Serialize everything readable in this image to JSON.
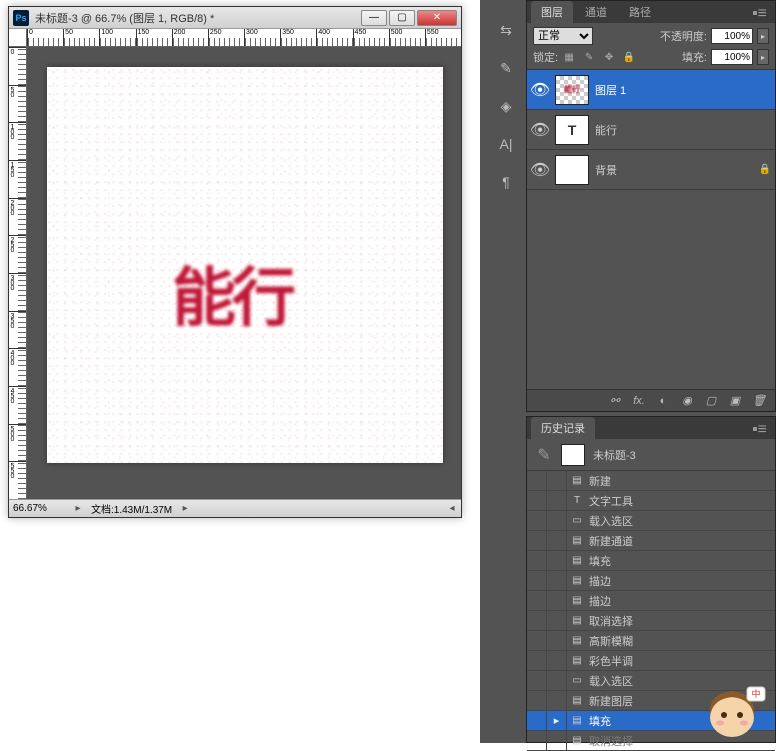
{
  "doc": {
    "title": "未标题-3 @ 66.7% (图层 1, RGB/8) *",
    "zoom": "66.67%",
    "filesize": "文档:1.43M/1.37M",
    "artwork_text": "能行"
  },
  "ruler_h": [
    "0",
    "50",
    "100",
    "150",
    "200",
    "250",
    "300",
    "350",
    "400",
    "450",
    "500",
    "550"
  ],
  "ruler_v": [
    "0",
    "50",
    "100",
    "150",
    "200",
    "250",
    "300",
    "350",
    "400",
    "450",
    "500",
    "550"
  ],
  "layers_panel": {
    "tabs": [
      "图层",
      "通道",
      "路径"
    ],
    "blend_mode": "正常",
    "opacity_label": "不透明度:",
    "opacity": "100%",
    "lock_label": "锁定:",
    "fill_label": "填充:",
    "fill": "100%",
    "layers": [
      {
        "name": "图层 1",
        "thumb_type": "art",
        "selected": true,
        "locked": false
      },
      {
        "name": "能行",
        "thumb_type": "text",
        "thumb_text": "T",
        "selected": false,
        "locked": false
      },
      {
        "name": "背景",
        "thumb_type": "white",
        "selected": false,
        "locked": true
      }
    ],
    "footer_fx": "fx."
  },
  "history_panel": {
    "tab": "历史记录",
    "doc_name": "未标题-3",
    "items": [
      {
        "icon": "▤",
        "label": "新建"
      },
      {
        "icon": "T",
        "label": "文字工具"
      },
      {
        "icon": "▭",
        "label": "载入选区"
      },
      {
        "icon": "▤",
        "label": "新建通道"
      },
      {
        "icon": "▤",
        "label": "填充"
      },
      {
        "icon": "▤",
        "label": "描边"
      },
      {
        "icon": "▤",
        "label": "描边"
      },
      {
        "icon": "▤",
        "label": "取消选择"
      },
      {
        "icon": "▤",
        "label": "高斯模糊"
      },
      {
        "icon": "▤",
        "label": "彩色半调"
      },
      {
        "icon": "▭",
        "label": "载入选区"
      },
      {
        "icon": "▤",
        "label": "新建图层"
      },
      {
        "icon": "▤",
        "label": "填充",
        "selected": true
      },
      {
        "icon": "▤",
        "label": "取消选择",
        "dim": true
      }
    ]
  }
}
